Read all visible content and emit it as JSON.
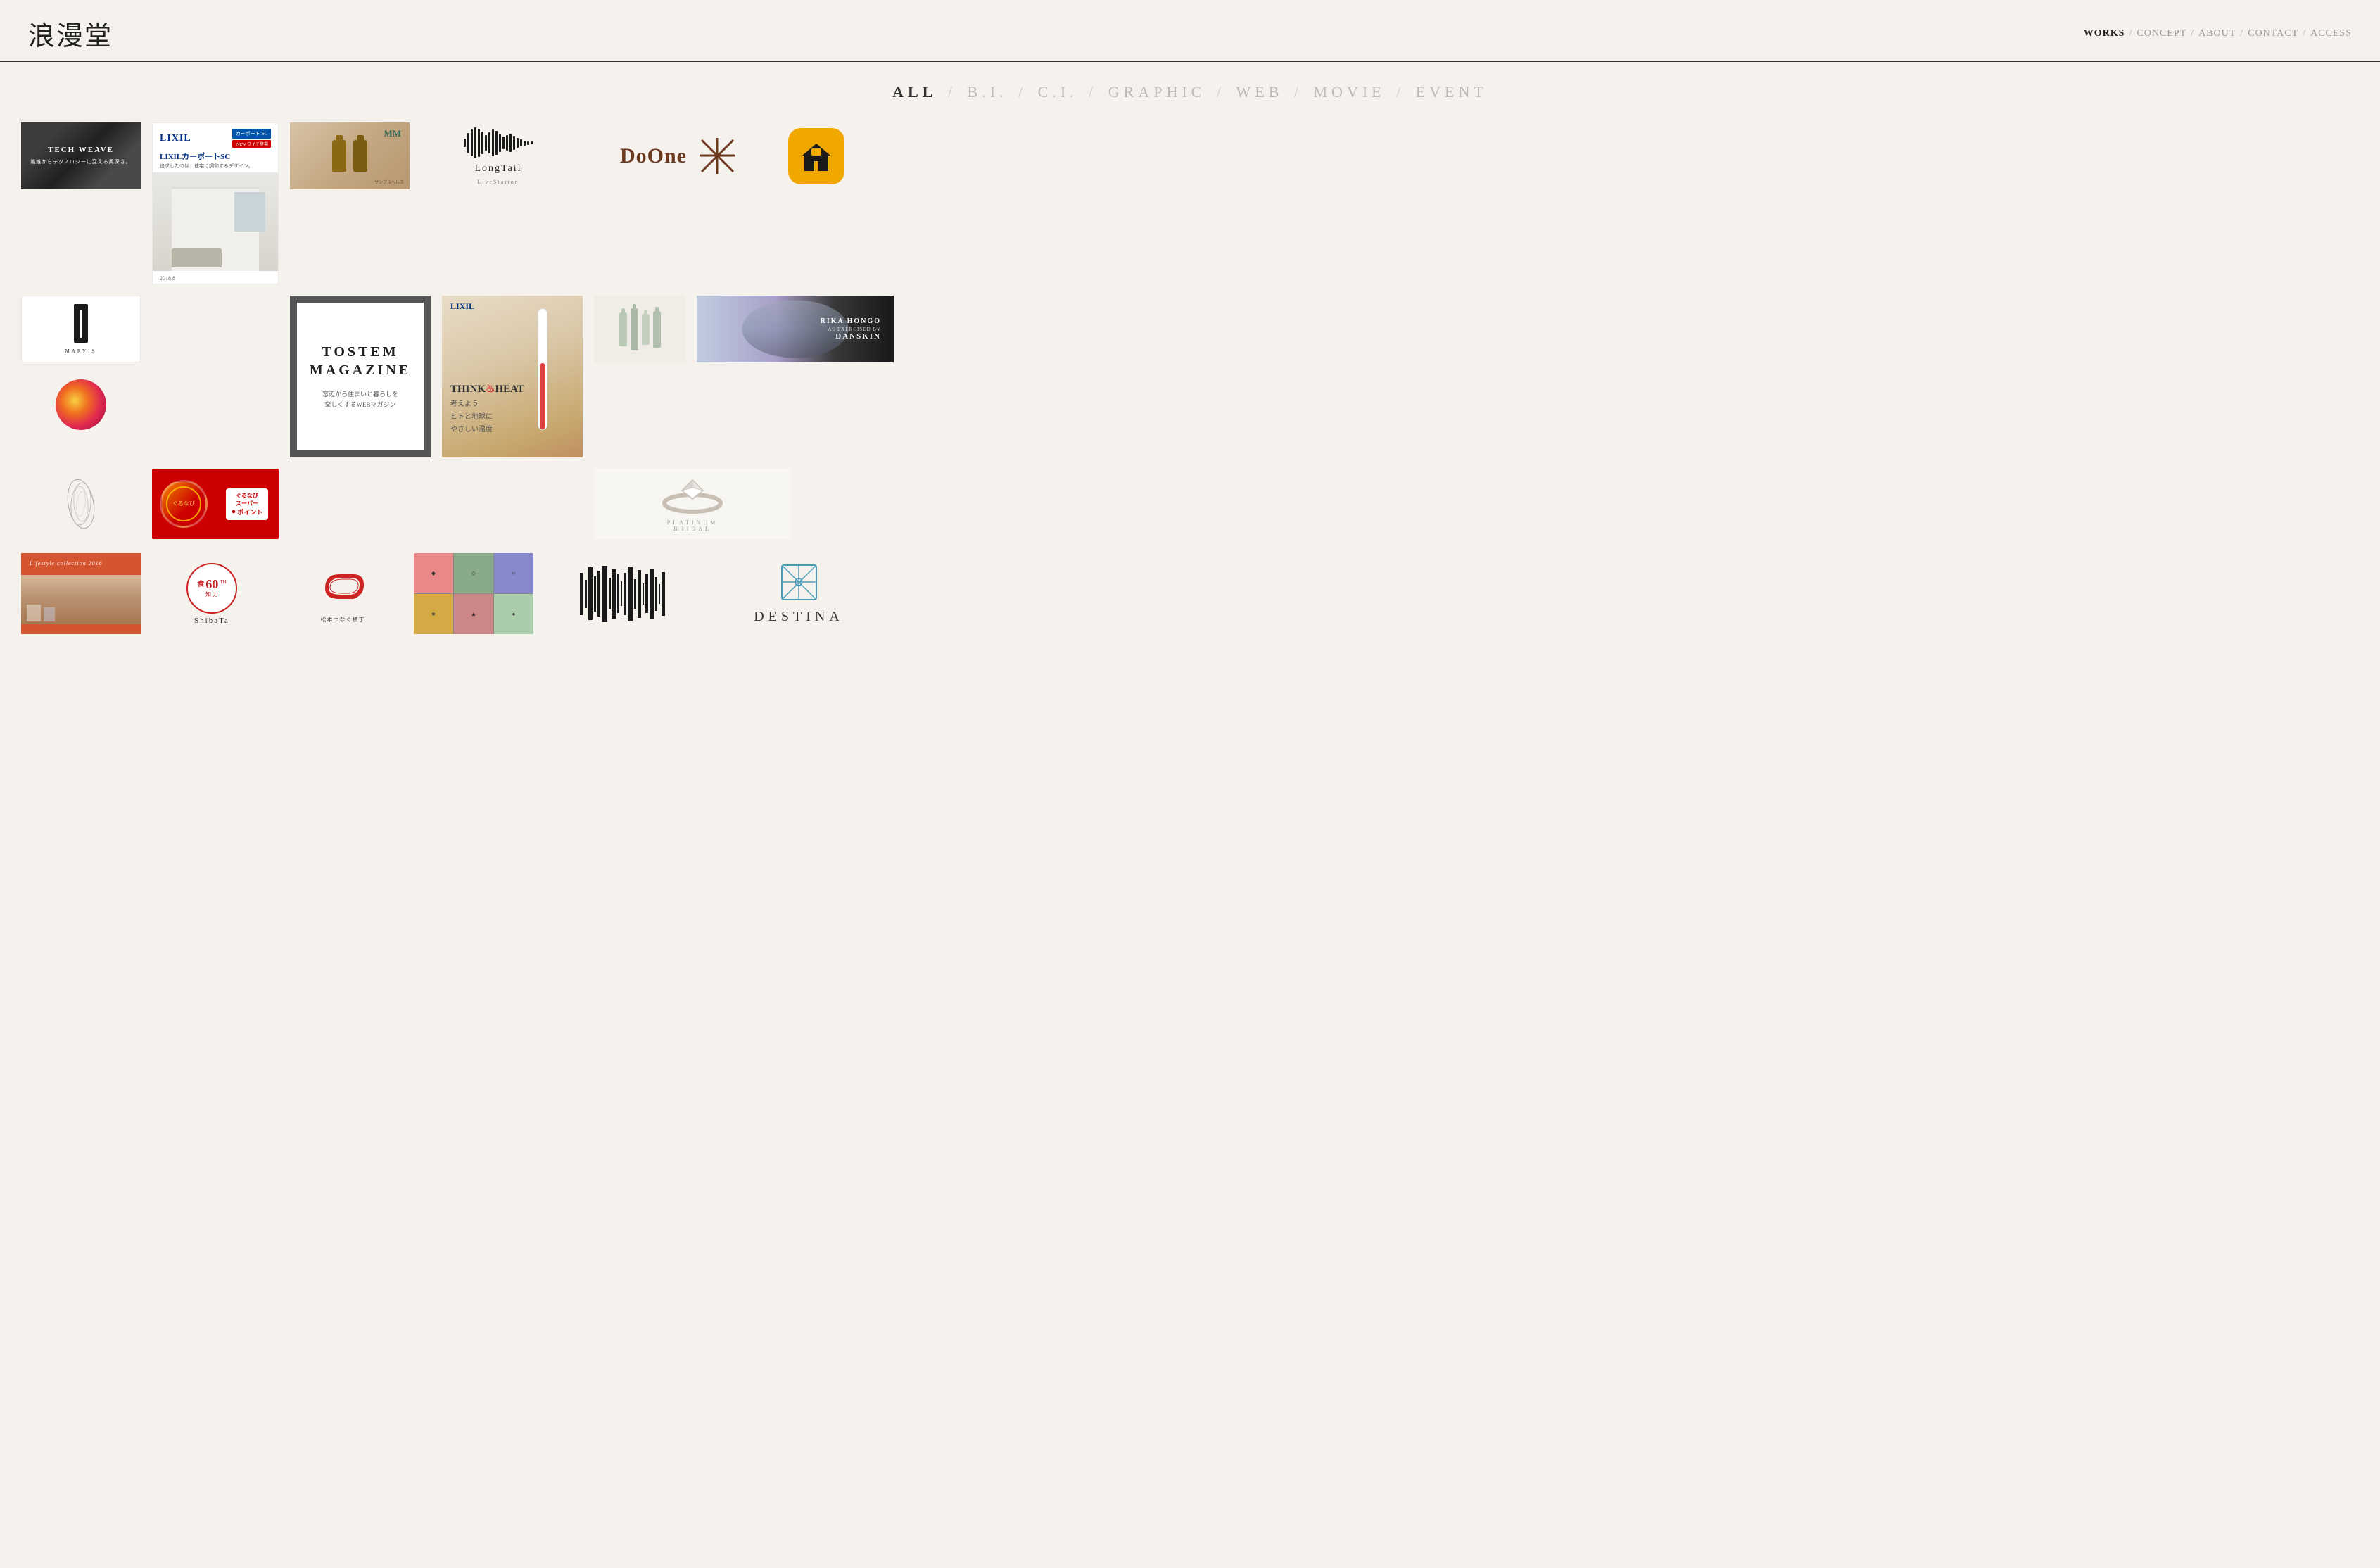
{
  "site": {
    "title": "浪漫堂",
    "nav": {
      "items": [
        {
          "label": "WORKS",
          "active": true
        },
        {
          "label": "CONCEPT",
          "active": false
        },
        {
          "label": "ABOUT",
          "active": false
        },
        {
          "label": "CONTACT",
          "active": false
        },
        {
          "label": "ACCESS",
          "active": false
        }
      ],
      "separator": "/"
    }
  },
  "filter": {
    "items": [
      {
        "label": "ALL",
        "active": true
      },
      {
        "label": "B.I.",
        "active": false
      },
      {
        "label": "C.I.",
        "active": false
      },
      {
        "label": "GRAPHIC",
        "active": false
      },
      {
        "label": "WEB",
        "active": false
      },
      {
        "label": "MOVIE",
        "active": false
      },
      {
        "label": "EVENT",
        "active": false
      }
    ]
  },
  "portfolio": {
    "items": [
      {
        "id": "tech-weave",
        "title": "TECH WEAVE",
        "subtitle": "繊維からテクノロジーに変える奥深さ。"
      },
      {
        "id": "lixil-carport",
        "title": "LIXILカーポートSC",
        "brand": "LIXIL",
        "badge": "カーポート SC",
        "new": "NEW ワイド登場",
        "tagline": "追求したのは、住宅に調和するデザイン。"
      },
      {
        "id": "sample-health",
        "title": "サンプルヘルス",
        "mm_logo": "MM"
      },
      {
        "id": "longtail",
        "title": "LongTail",
        "subtitle": "LiveStation"
      },
      {
        "id": "doone",
        "title": "DoOne"
      },
      {
        "id": "app-icon",
        "title": "App Icon"
      },
      {
        "id": "marvis",
        "title": "MARVIS"
      },
      {
        "id": "color-circle",
        "title": "Color Circle"
      },
      {
        "id": "tostem",
        "title": "TOSTEM MAGAZINE",
        "subtitle": "窓辺から住まいと暮らしを楽しくするWEBマガジン"
      },
      {
        "id": "lixil-think",
        "brand": "LIXIL",
        "title": "THINK HEAT",
        "subtitle": "考えよう ヒトと地球にやさしい温度"
      },
      {
        "id": "cosmetics",
        "title": "Cosmetics"
      },
      {
        "id": "danskin",
        "title": "RIKA HONGO",
        "subtitle": "AS EXERCISED BY DANSKIN"
      },
      {
        "id": "sculpture",
        "title": "Sculpture"
      },
      {
        "id": "gurunavi",
        "title": "ぐるなびスーパーポイント"
      },
      {
        "id": "bridal",
        "title": "PLATINUM BRIDAL"
      },
      {
        "id": "lifestyle",
        "title": "Lifestyle collection 2016"
      },
      {
        "id": "shibata",
        "title": "ShibaTa",
        "num": "60",
        "kanji": "食知力"
      },
      {
        "id": "matsumoto",
        "title": "松本つなぐ横丁"
      },
      {
        "id": "badges",
        "title": "Badges"
      },
      {
        "id": "barcode",
        "title": "Barcode Audio"
      },
      {
        "id": "destina",
        "title": "DESTINA"
      }
    ]
  }
}
